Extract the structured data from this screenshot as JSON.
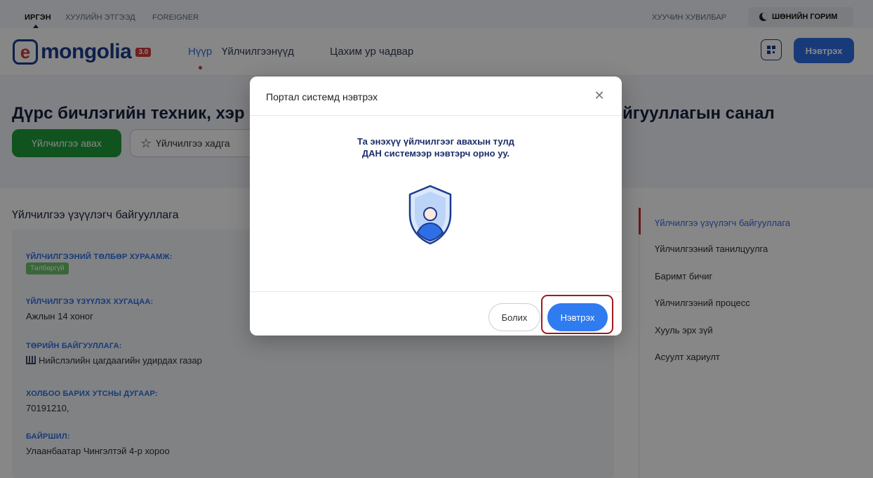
{
  "topbar": {
    "languages": [
      "ИРГЭН",
      "ХУУЛИЙН ЭТГЭЭД",
      "FOREIGNER"
    ],
    "old_version": "ХУУЧИН ХУВИЛБАР",
    "dark_mode": "ШӨНИЙН ГОРИМ"
  },
  "nav": {
    "logo_text": "mongolia",
    "logo_badge": "3.0",
    "links": [
      "Нүүр",
      "Үйлчилгээнүүд",
      "Цахим ур чадвар"
    ],
    "login": "Нэвтрэх"
  },
  "hero": {
    "title_left": "Дүрс бичлэгийн техник, хэр",
    "title_right": "йгууллагын санал",
    "service_button": "Үйлчилгээ авах",
    "save_button": "Үйлчилгээ хадга"
  },
  "main": {
    "section_title": "Үйлчилгээ үзүүлэгч байгууллага",
    "fields": [
      {
        "label": "ҮЙЛЧИЛГЭЭНИЙ ТӨЛБӨР ХУРААМЖ:",
        "value": "Төлбөргүй"
      },
      {
        "label": "ҮЙЛЧИЛГЭЭ ҮЗҮҮЛЭХ ХУГАЦАА:",
        "value": "Ажлын 14 хоног"
      },
      {
        "label": "ТӨРИЙН БАЙГУУЛЛАГА:",
        "value": "Нийслэлийн цагдаагийн удирдах газар"
      },
      {
        "label": "ХОЛБОО БАРИХ УТСНЫ ДУГААР:",
        "value": "70191210,"
      },
      {
        "label": "БАЙРШИЛ:",
        "value": "Улаанбаатар Чингэлтэй 4-р хороо"
      }
    ]
  },
  "side_nav": {
    "items": [
      "Үйлчилгээ үзүүлэгч байгууллага",
      "Үйлчилгээний танилцуулга",
      "Баримт бичиг",
      "Үйлчилгээний процесс",
      "Хууль эрх зүй",
      "Асуулт хариулт"
    ]
  },
  "modal": {
    "title": "Портал системд нэвтрэх",
    "message_line1": "Та энэхүү үйлчилгээг авахын тулд",
    "message_line2": "ДАН системээр нэвтэрч орно уу.",
    "cancel": "Болих",
    "login": "Нэвтрэх"
  },
  "colors": {
    "brand_blue": "#2f6fe5",
    "brand_navy": "#1c3b8f",
    "accent_red": "#d43a3a",
    "service_green": "#1f9d3a"
  }
}
